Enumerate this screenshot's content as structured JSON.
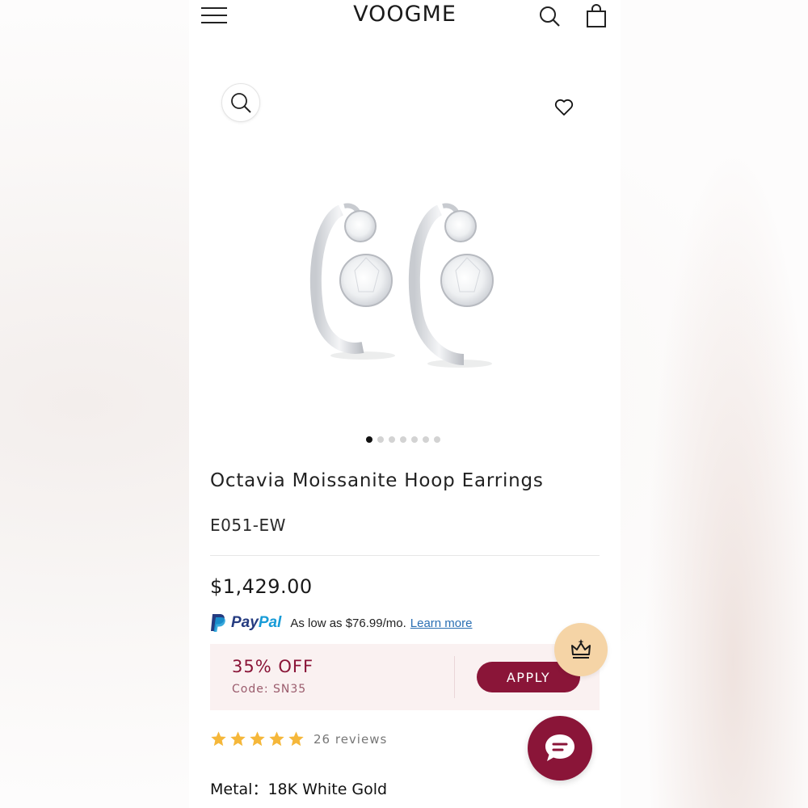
{
  "header": {
    "brand": "VOOGME",
    "menu_icon": "hamburger-menu-icon",
    "search_icon": "search-icon",
    "cart_icon": "shopping-bag-icon"
  },
  "gallery": {
    "zoom_icon": "zoom-search-icon",
    "wishlist_icon": "heart-icon",
    "image_count": 7,
    "active_index": 0
  },
  "product": {
    "title": "Octavia Moissanite Hoop Earrings",
    "sku": "E051-EW",
    "price": "$1,429.00"
  },
  "paypal": {
    "brand_pay": "Pay",
    "brand_pal": "Pal",
    "text": "As low as $76.99/mo.",
    "link": "Learn more"
  },
  "coupon": {
    "discount": "35% OFF",
    "code": "Code: SN35",
    "apply_label": "APPLY"
  },
  "rating": {
    "stars": 5,
    "reviews": "26 reviews"
  },
  "options": {
    "metal_label": "Metal：",
    "metal_value": "18K White Gold"
  },
  "colors": {
    "accent": "#8a1538",
    "coupon_bg": "#faf1f1",
    "star": "#f5b73a",
    "crown_bg": "#f5d4a6"
  }
}
